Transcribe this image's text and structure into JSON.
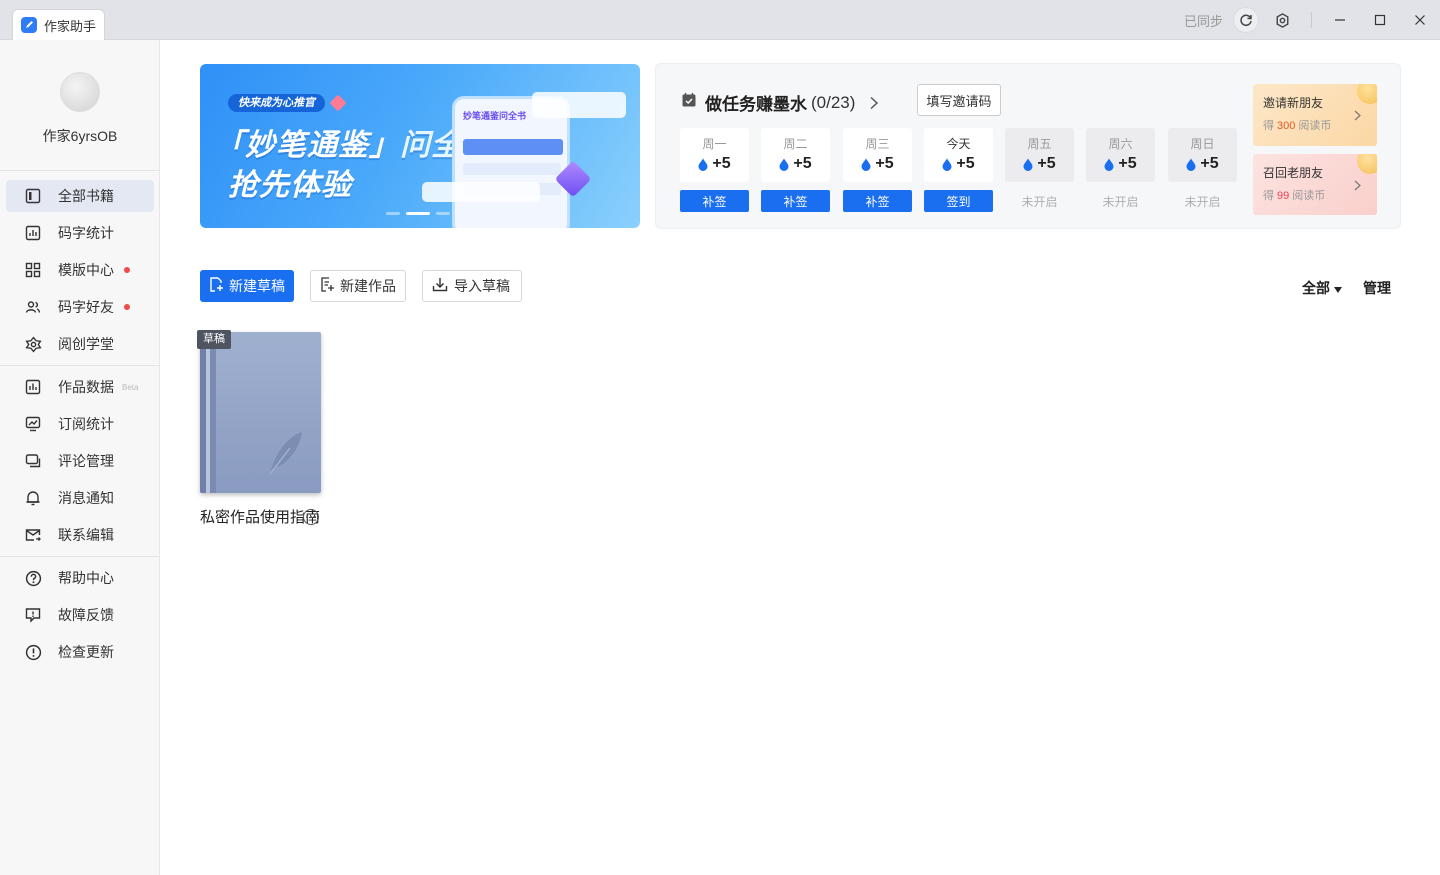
{
  "titlebar": {
    "tab_label": "作家助手",
    "sync_status": "已同步"
  },
  "sidebar": {
    "username": "作家6yrsOB",
    "items": [
      {
        "label": "全部书籍",
        "icon": "bookshelf-icon"
      },
      {
        "label": "码字统计",
        "icon": "bar-chart-icon"
      },
      {
        "label": "模版中心",
        "icon": "grid-icon",
        "dot": true
      },
      {
        "label": "码字好友",
        "icon": "friends-icon",
        "dot": true
      },
      {
        "label": "阅创学堂",
        "icon": "flower-icon"
      },
      {
        "label": "作品数据",
        "icon": "data-chart-icon",
        "badge": "Beta"
      },
      {
        "label": "订阅统计",
        "icon": "trend-icon"
      },
      {
        "label": "评论管理",
        "icon": "comment-icon"
      },
      {
        "label": "消息通知",
        "icon": "bell-icon"
      },
      {
        "label": "联系编辑",
        "icon": "mail-icon"
      },
      {
        "label": "帮助中心",
        "icon": "help-icon"
      },
      {
        "label": "故障反馈",
        "icon": "feedback-icon"
      },
      {
        "label": "检查更新",
        "icon": "update-icon"
      }
    ]
  },
  "banner": {
    "tag": "快来成为心推官",
    "headline_1a": "「妙笔通鉴」",
    "headline_1b": "问全书",
    "headline_2": "抢先体验",
    "phone_title": "妙笔通鉴问全书"
  },
  "task": {
    "title": "做任务赚墨水",
    "progress": "(0/23)",
    "invite_code_label": "填写邀请码",
    "days": [
      {
        "name": "周一",
        "reward": "+5",
        "action": "补签",
        "state": "past"
      },
      {
        "name": "周二",
        "reward": "+5",
        "action": "补签",
        "state": "past"
      },
      {
        "name": "周三",
        "reward": "+5",
        "action": "补签",
        "state": "past"
      },
      {
        "name": "今天",
        "reward": "+5",
        "action": "签到",
        "state": "today"
      },
      {
        "name": "周五",
        "reward": "+5",
        "action": "未开启",
        "state": "locked"
      },
      {
        "name": "周六",
        "reward": "+5",
        "action": "未开启",
        "state": "locked"
      },
      {
        "name": "周日",
        "reward": "+5",
        "action": "未开启",
        "state": "locked"
      }
    ],
    "promos": [
      {
        "title": "邀请新朋友",
        "prefix": "得",
        "amount": "300",
        "unit": "阅读币"
      },
      {
        "title": "召回老朋友",
        "prefix": "得",
        "amount": "99",
        "unit": "阅读币"
      }
    ]
  },
  "toolbar": {
    "new_draft": "新建草稿",
    "new_work": "新建作品",
    "import_draft": "导入草稿",
    "filter": "全部",
    "manage": "管理"
  },
  "books": [
    {
      "tag": "草稿",
      "title": "私密作品使用指南"
    }
  ],
  "colors": {
    "primary": "#1a6ef0",
    "sidebar_bg": "#f7f7f8",
    "titlebar_bg": "#e1e3e8",
    "dot": "#f04a4a"
  }
}
